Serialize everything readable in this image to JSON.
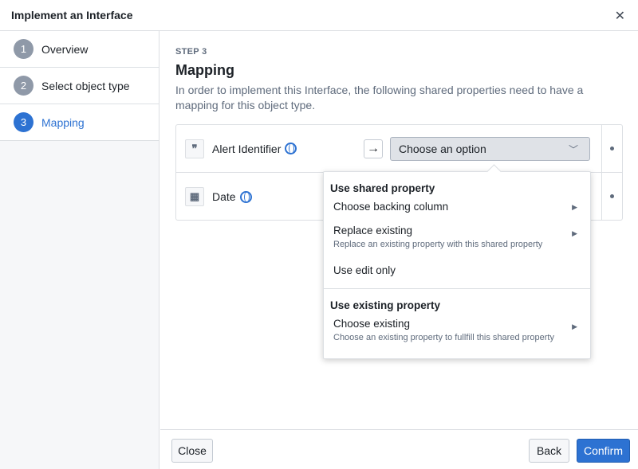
{
  "dialog": {
    "title": "Implement an Interface",
    "close_icon": "close-icon"
  },
  "steps": [
    {
      "num": "1",
      "label": "Overview"
    },
    {
      "num": "2",
      "label": "Select object type"
    },
    {
      "num": "3",
      "label": "Mapping",
      "active": true
    }
  ],
  "main": {
    "step_label": "STEP 3",
    "heading": "Mapping",
    "description": "In order to implement this Interface, the following shared properties need to have a mapping for this object type."
  },
  "rows": [
    {
      "icon": "quote-icon",
      "name": "Alert Identifier",
      "select": "Choose an option"
    },
    {
      "icon": "calendar-icon",
      "name": "Date"
    }
  ],
  "menu": {
    "group1": "Use shared property",
    "items1": [
      {
        "label": "Choose backing column"
      },
      {
        "label": "Replace existing",
        "sub": "Replace an existing property with this shared property"
      },
      {
        "label": "Use edit only"
      }
    ],
    "group2": "Use existing property",
    "items2": [
      {
        "label": "Choose existing",
        "sub": "Choose an existing property to fullfill this shared property"
      }
    ]
  },
  "footer": {
    "close": "Close",
    "back": "Back",
    "confirm": "Confirm"
  },
  "colors": {
    "accent": "#2d72d2"
  }
}
